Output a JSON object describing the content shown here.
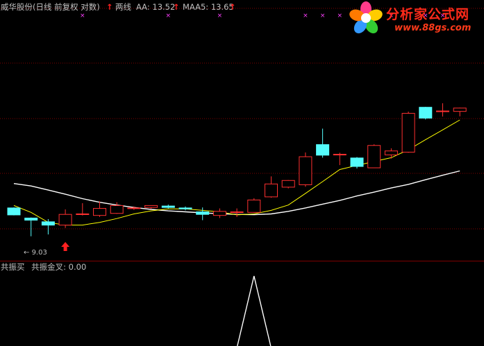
{
  "header": {
    "title": "威华股份(日线 前复权 对数)",
    "indicator_name": "两线",
    "aa_label": "AA: 13.52",
    "maa_label": "MAA5: 13.65",
    "arrow_glyph": "↑"
  },
  "sub_panel": {
    "name": "共振买",
    "value_label": "共振金叉: 0.00"
  },
  "low_marker": "9.03",
  "watermark": {
    "brand": "分析家公式网",
    "url": "www.88gs.com"
  },
  "colors": {
    "up": "#ff3030",
    "down": "#54fcfc",
    "ma_long": "#ffffff",
    "ma_short": "#ffff00",
    "grid": "#800000",
    "signal": "#ffffff",
    "cross": "#ff40ff"
  },
  "chart_data": {
    "type": "candlestick",
    "title": "威华股份(日线 前复权 对数)",
    "scale": "log",
    "grid": true,
    "candles": [
      {
        "o": 12.0,
        "h": 12.05,
        "l": 11.25,
        "c": 11.3
      },
      {
        "o": 11.0,
        "h": 11.05,
        "l": 9.4,
        "c": 10.8
      },
      {
        "o": 10.65,
        "h": 10.9,
        "l": 9.55,
        "c": 10.35
      },
      {
        "o": 10.35,
        "h": 11.85,
        "l": 10.1,
        "c": 11.35
      },
      {
        "o": 11.35,
        "h": 12.5,
        "l": 11.25,
        "c": 11.4
      },
      {
        "o": 11.25,
        "h": 12.7,
        "l": 11.1,
        "c": 11.95
      },
      {
        "o": 11.45,
        "h": 12.6,
        "l": 11.4,
        "c": 12.25
      },
      {
        "o": 11.95,
        "h": 12.15,
        "l": 11.8,
        "c": 12.0
      },
      {
        "o": 12.05,
        "h": 12.25,
        "l": 11.9,
        "c": 12.25
      },
      {
        "o": 12.2,
        "h": 12.35,
        "l": 11.95,
        "c": 12.05
      },
      {
        "o": 12.0,
        "h": 12.15,
        "l": 11.75,
        "c": 11.9
      },
      {
        "o": 11.6,
        "h": 12.05,
        "l": 10.8,
        "c": 11.35
      },
      {
        "o": 11.25,
        "h": 11.95,
        "l": 11.0,
        "c": 11.65
      },
      {
        "o": 11.6,
        "h": 11.95,
        "l": 11.1,
        "c": 11.6
      },
      {
        "o": 11.55,
        "h": 13.05,
        "l": 11.5,
        "c": 12.85
      },
      {
        "o": 13.2,
        "h": 15.75,
        "l": 13.1,
        "c": 14.75
      },
      {
        "o": 14.35,
        "h": 15.25,
        "l": 14.2,
        "c": 15.2
      },
      {
        "o": 14.65,
        "h": 19.35,
        "l": 14.4,
        "c": 18.65
      },
      {
        "o": 20.7,
        "h": 23.75,
        "l": 18.5,
        "c": 18.9
      },
      {
        "o": 19.05,
        "h": 19.3,
        "l": 17.35,
        "c": 19.05
      },
      {
        "o": 18.45,
        "h": 18.6,
        "l": 16.85,
        "c": 17.15
      },
      {
        "o": 16.95,
        "h": 20.75,
        "l": 16.9,
        "c": 20.55
      },
      {
        "o": 18.95,
        "h": 20.05,
        "l": 18.35,
        "c": 19.6
      },
      {
        "o": 19.4,
        "h": 27.5,
        "l": 19.3,
        "c": 27.1
      },
      {
        "o": 28.55,
        "h": 28.65,
        "l": 25.7,
        "c": 26.0
      },
      {
        "o": 27.55,
        "h": 29.55,
        "l": 26.35,
        "c": 27.65
      },
      {
        "o": 27.55,
        "h": 28.45,
        "l": 26.4,
        "c": 28.35
      }
    ],
    "series": [
      {
        "name": "AA",
        "values": [
          14.8,
          14.5,
          14.0,
          13.5,
          13.0,
          12.6,
          12.3,
          12.05,
          11.85,
          11.7,
          11.6,
          11.5,
          11.42,
          11.35,
          11.32,
          11.4,
          11.65,
          12.0,
          12.4,
          12.8,
          13.3,
          13.75,
          14.25,
          14.7,
          15.3,
          15.9,
          16.5
        ]
      },
      {
        "name": "MAA5",
        "values": [
          12.25,
          11.55,
          10.6,
          10.35,
          10.35,
          10.6,
          10.95,
          11.4,
          11.7,
          11.9,
          11.9,
          11.75,
          11.6,
          11.3,
          11.4,
          11.75,
          12.3,
          13.6,
          15.05,
          16.7,
          17.3,
          17.9,
          18.5,
          19.8,
          21.6,
          23.5,
          25.6
        ]
      }
    ],
    "signal": {
      "name": "共振金叉",
      "values": [
        0,
        0,
        0,
        0,
        0,
        0,
        0,
        0,
        0,
        0,
        0,
        0,
        0,
        0,
        1,
        0,
        0,
        0,
        0,
        0,
        0,
        0,
        0,
        0,
        0,
        0,
        0
      ]
    },
    "markers": {
      "low_label": "9.03",
      "buy_arrow_index": 3,
      "cross_indices": [
        4,
        9,
        12,
        17,
        18,
        19,
        20,
        21,
        22,
        24,
        25
      ]
    }
  }
}
